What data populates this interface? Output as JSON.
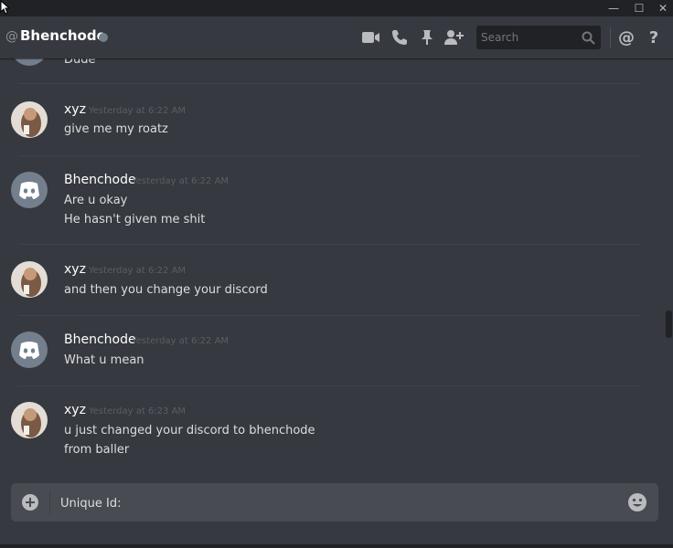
{
  "window": {
    "controls": [
      {
        "name": "minimize-button",
        "glyph": "—"
      },
      {
        "name": "maximize-button",
        "glyph": "☐"
      },
      {
        "name": "close-window-button",
        "glyph": "✕"
      }
    ]
  },
  "header": {
    "at_symbol": "@",
    "title": "Bhenchode",
    "status_color": "#747f8d",
    "icons": [
      "video-call-icon",
      "voice-call-icon",
      "pin-icon",
      "add-friend-icon",
      "mention-icon",
      "help-icon"
    ],
    "search_placeholder": "Search",
    "mention_symbol": "@",
    "help_symbol": "?"
  },
  "messages": [
    {
      "author": "",
      "timestamp": "",
      "lines": [
        "Dude"
      ],
      "avatar": "discord-logo-avatar"
    },
    {
      "author": "xyz",
      "timestamp": "Yesterday at 6:22 AM",
      "lines": [
        "give me my roatz"
      ],
      "avatar": "photo-avatar"
    },
    {
      "author": "Bhenchode",
      "timestamp": "Yesterday at 6:22 AM",
      "lines": [
        "Are u okay",
        "He hasn't given me shit"
      ],
      "avatar": "discord-logo-avatar"
    },
    {
      "author": "xyz",
      "timestamp": "Yesterday at 6:22 AM",
      "lines": [
        "and then you change your discord"
      ],
      "avatar": "photo-avatar"
    },
    {
      "author": "Bhenchode",
      "timestamp": "Yesterday at 6:22 AM",
      "lines": [
        "What u mean"
      ],
      "avatar": "discord-logo-avatar"
    },
    {
      "author": "xyz",
      "timestamp": "Yesterday at 6:23 AM",
      "lines": [
        "u just changed your discord to bhenchode",
        "from baller"
      ],
      "avatar": "photo-avatar"
    }
  ],
  "composer": {
    "value": "Unique Id:",
    "add_icon": "plus-circle-icon",
    "emoji_icon": "emoji-icon"
  },
  "colors": {
    "background": "#36393f",
    "titlebar": "#202225",
    "composer": "#484b51",
    "avatar_discord_bg": "#747f8d"
  }
}
